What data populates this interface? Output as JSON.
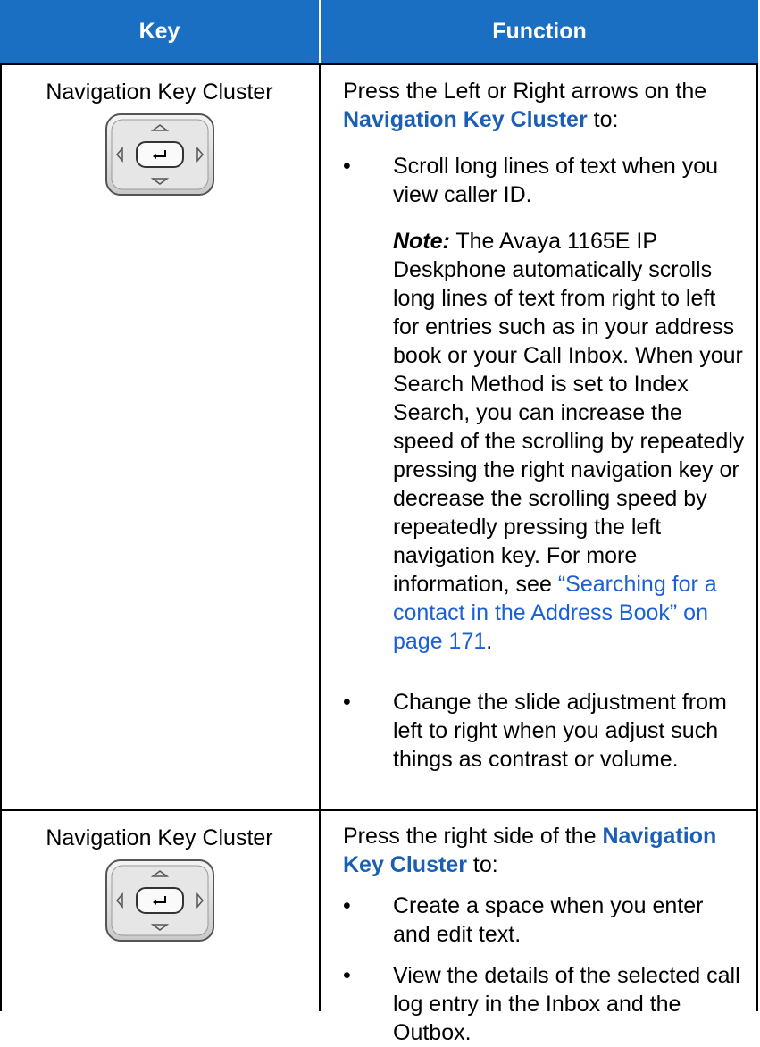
{
  "header": {
    "key": "Key",
    "function": "Function"
  },
  "rows": [
    {
      "key_label": "Navigation Key Cluster",
      "intro_pre": "Press the Left or Right arrows on the ",
      "intro_strong": "Navigation Key Cluster",
      "intro_post": " to:",
      "bullet1": "Scroll long lines of text when you view caller ID.",
      "note_label": "Note:",
      "note_text": " The Avaya 1165E IP Deskphone automatically scrolls long lines of text from right to left for entries such as in your address book or your Call Inbox. When your Search Method is set to Index Search, you can increase the speed of the scrolling by repeatedly pressing the right navigation key or decrease the scrolling speed by repeatedly pressing the left navigation key. For more information, see ",
      "note_link": "“Searching for a contact in the Address Book” on page 171",
      "note_end": ".",
      "bullet2": "Change the slide adjustment from left to right when you adjust such things as contrast or volume."
    },
    {
      "key_label": "Navigation Key Cluster",
      "intro_pre": "Press the right side of the ",
      "intro_strong": "Navigation Key Cluster",
      "intro_post": " to:",
      "bullet1": "Create a space when you enter and edit text.",
      "bullet2": "View the details of the selected call log entry in the Inbox and the Outbox."
    }
  ],
  "bullet_glyph": "•"
}
